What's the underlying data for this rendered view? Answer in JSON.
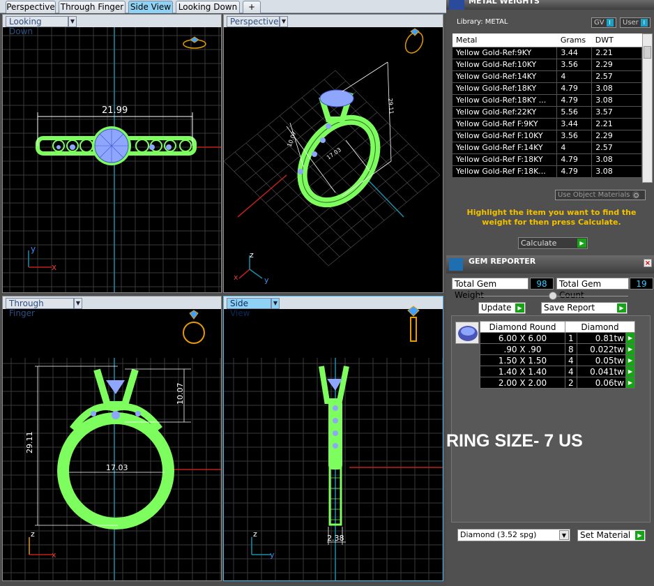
{
  "tabs": [
    "Perspective",
    "Through Finger",
    "Side View",
    "Looking Down",
    "+"
  ],
  "active_tab": "Side View",
  "viewports": {
    "top_left": {
      "label": "Looking Down",
      "dim": "21.99",
      "axis1": "y",
      "axis2": "x"
    },
    "top_right": {
      "label": "Perspective",
      "dim1": "10.07",
      "dim2": "17.03",
      "dim3": "29.11",
      "axis1": "z",
      "axis2": "x",
      "axis3": "y"
    },
    "bottom_left": {
      "label": "Through Finger",
      "dim_h": "29.11",
      "dim_v": "10.07",
      "dim_w": "17.03",
      "axis1": "z",
      "axis2": "x"
    },
    "bottom_right": {
      "label": "Side View",
      "dim": "2.38",
      "axis1": "z",
      "axis2": "y"
    }
  },
  "metal_panel": {
    "title": "METAL WEIGHTS",
    "library_label": "Library: METAL",
    "gv_label": "GV",
    "user_label": "User",
    "columns": [
      "Metal",
      "Grams",
      "DWT"
    ],
    "rows": [
      [
        "Yellow Gold-Ref:9KY",
        "3.44",
        "2.21"
      ],
      [
        "Yellow Gold-Ref:10KY",
        "3.56",
        "2.29"
      ],
      [
        "Yellow Gold-Ref:14KY",
        "4",
        "2.57"
      ],
      [
        "Yellow Gold-Ref:18KY",
        "4.79",
        "3.08"
      ],
      [
        "Yellow Gold-Ref:18KY ...",
        "4.79",
        "3.08"
      ],
      [
        "Yellow Gold-Ref:22KY",
        "5.56",
        "3.57"
      ],
      [
        "Yellow Gold-Ref F:9KY",
        "3.44",
        "2.21"
      ],
      [
        "Yellow Gold-Ref F:10KY",
        "3.56",
        "2.29"
      ],
      [
        "Yellow Gold-Ref F:14KY",
        "4",
        "2.57"
      ],
      [
        "Yellow Gold-Ref F:18KY",
        "4.79",
        "3.08"
      ],
      [
        "Yellow Gold-Ref F:18K...",
        "4.79",
        "3.08"
      ]
    ],
    "use_object_materials": "Use Object Materials",
    "hint": "Highlight the item you want to find the weight for then press Calculate.",
    "calculate_label": "Calculate"
  },
  "gem_panel": {
    "title": "GEM REPORTER",
    "total_weight_label": "Total Gem Weight",
    "total_weight_value": "98",
    "total_count_label": "Total Gem Count",
    "total_count_value": "19",
    "update_label": "Update",
    "save_report_label": "Save Report",
    "columns": [
      "Diamond Round",
      "Diamond"
    ],
    "rows": [
      [
        "6.00 X 6.00",
        "1",
        "0.81tw"
      ],
      [
        ".90 X .90",
        "8",
        "0.022tw"
      ],
      [
        "1.50 X 1.50",
        "4",
        "0.05tw"
      ],
      [
        "1.40 X 1.40",
        "4",
        "0.041tw"
      ],
      [
        "2.00 X 2.00",
        "2",
        "0.06tw"
      ]
    ],
    "material_select": "Diamond     (3.52 spg)",
    "set_material_label": "Set Material"
  },
  "ring_size_text": "RING SIZE- 7 US",
  "colors": {
    "wire_green": "#7dfd5e",
    "gem_blue": "#8fa6ff",
    "grid": "#3a3a3a",
    "accent_cyan": "#38c9ff",
    "hint_yellow": "#f2c200"
  }
}
